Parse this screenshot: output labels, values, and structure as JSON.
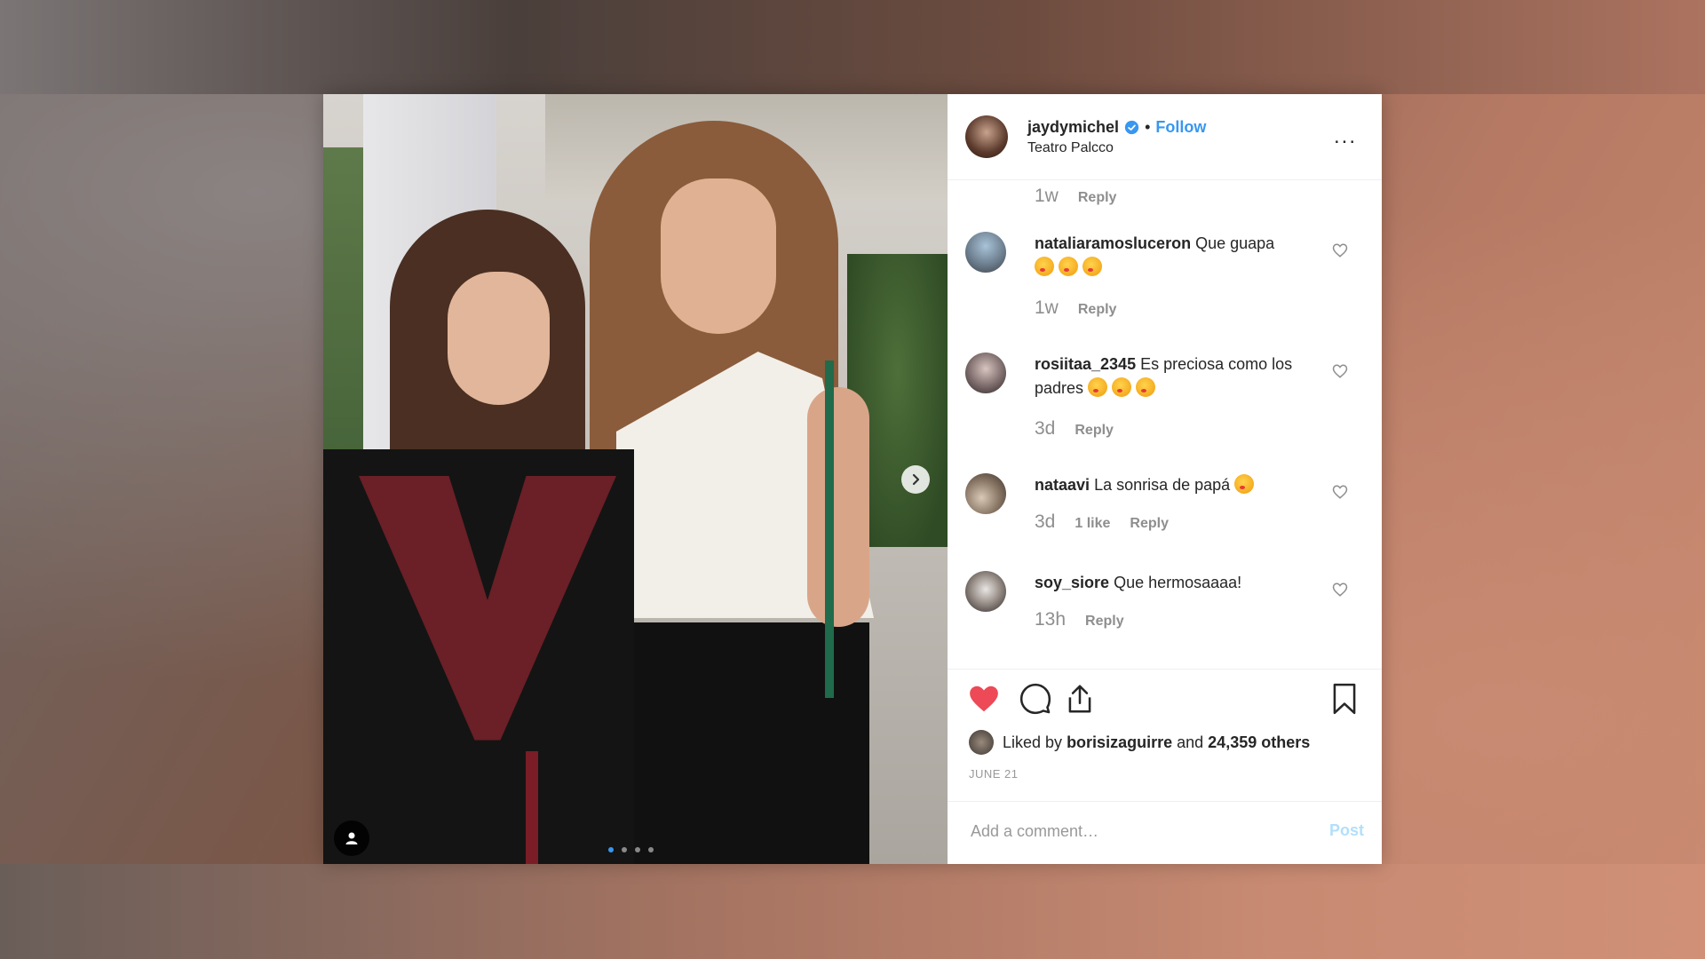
{
  "post": {
    "username": "jaydymichel",
    "follow_label": "Follow",
    "separator": "•",
    "location": "Teatro Palcco",
    "more_label": "..."
  },
  "comments": {
    "first": {
      "time": "1w",
      "reply": "Reply"
    },
    "items": [
      {
        "user": "nataliaramosluceron",
        "text": "Que guapa",
        "emoji_count": 3,
        "time": "1w",
        "likes": "",
        "reply": "Reply"
      },
      {
        "user": "rosiitaa_2345",
        "text": "Es preciosa como los padres",
        "emoji_count": 3,
        "time": "3d",
        "likes": "",
        "reply": "Reply"
      },
      {
        "user": "nataavi",
        "text": "La sonrisa de papá",
        "emoji_count": 1,
        "time": "3d",
        "likes": "1 like",
        "reply": "Reply"
      },
      {
        "user": "soy_siore",
        "text": "Que hermosaaaa!",
        "emoji_count": 0,
        "time": "13h",
        "likes": "",
        "reply": "Reply"
      }
    ]
  },
  "actions": {
    "liked_by_prefix": "Liked by",
    "liked_by_user": "borisizaguirre",
    "liked_by_and": "and",
    "liked_by_count": "24,359 others",
    "date": "JUNE 21"
  },
  "add_comment": {
    "placeholder": "Add a comment…",
    "post_label": "Post"
  },
  "carousel": {
    "dot_count": 4,
    "active_index": 0
  },
  "colors": {
    "accent": "#3897f0",
    "like_red": "#ed4956",
    "post_disabled": "#b2dffc"
  }
}
